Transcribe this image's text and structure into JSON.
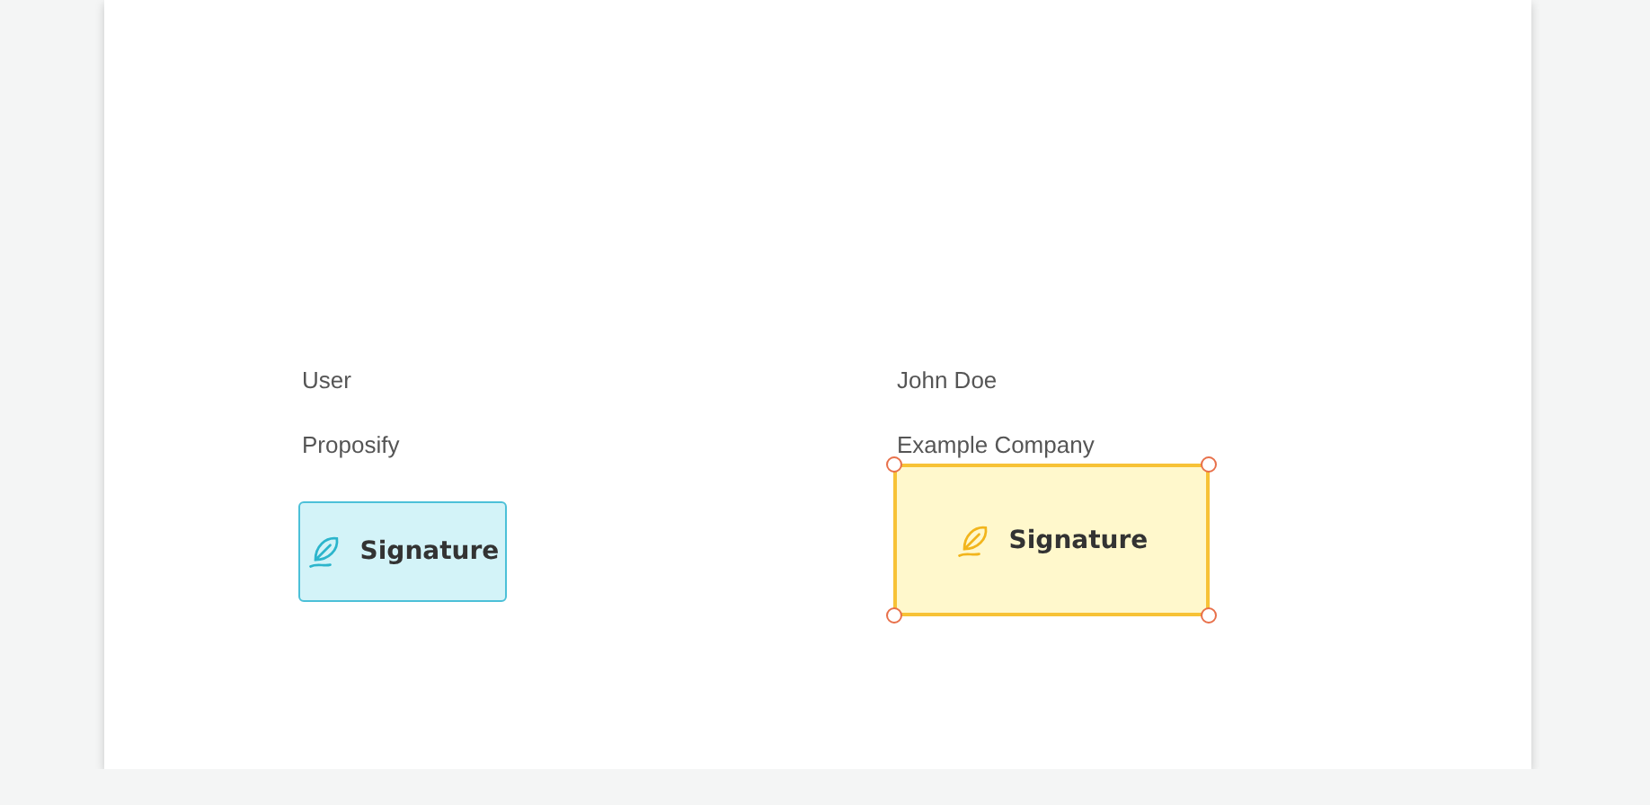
{
  "parties": [
    {
      "name": "User",
      "company": "Proposify",
      "signature": {
        "label": "Signature",
        "kind": "sender",
        "selected": false
      }
    },
    {
      "name": "John Doe",
      "company": "Example Company",
      "signature": {
        "label": "Signature",
        "kind": "recipient",
        "selected": true
      }
    }
  ]
}
